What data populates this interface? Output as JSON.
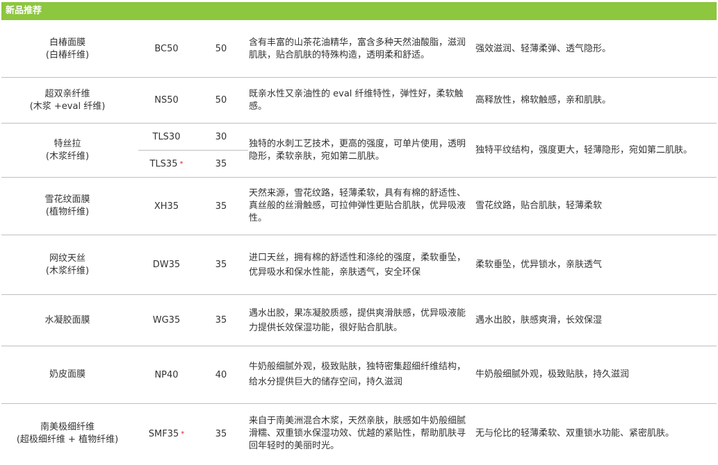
{
  "header": {
    "title": "新品推荐"
  },
  "rows": [
    {
      "name": "白椿面膜",
      "sub": "(白椿纤维)",
      "code": "BC50",
      "gsm": "50",
      "desc": "含有丰富的山茶花油精华，富含多种天然油酸脂，滋润肌肤，贴合肌肤的特殊构造，透明柔和舒适。",
      "feature": "强效滋润、轻薄柔弹、透气隐形。"
    },
    {
      "name": "超双亲纤维",
      "sub": "(木浆 +eval 纤维)",
      "code": "NS50",
      "gsm": "50",
      "desc": "既亲水性又亲油性的 eval 纤维特性，弹性好，柔软触感。",
      "feature": "高释放性，棉软触感，亲和肌肤。"
    },
    {
      "name": "特丝拉",
      "sub": "(木浆纤维)",
      "code": "TLS30",
      "gsm": "30",
      "code2": "TLS35",
      "star2": "*",
      "gsm2": "35",
      "desc": "独特的水刺工艺技术，更高的强度，可单片使用，透明隐形，柔软亲肤，宛如第二肌肤。",
      "feature": "独特平纹结构，强度更大，轻薄隐形，宛如第二肌肤。"
    },
    {
      "name": "雪花纹面膜",
      "sub": "(植物纤维)",
      "code": "XH35",
      "gsm": "35",
      "desc": "天然来源，雪花纹路，轻薄柔软，具有有棉的舒适性、真丝般的丝滑触感，可拉伸弹性更贴合肌肤，优异吸液性。",
      "feature": "雪花纹路，贴合肌肤，轻薄柔软"
    },
    {
      "name": "网纹天丝",
      "sub": "(木浆纤维)",
      "code": "DW35",
      "gsm": "35",
      "desc": "进口天丝，拥有棉的舒适性和涤纶的强度，柔软垂坠，优异吸水和保水性能，亲肤透气，安全环保",
      "feature": "柔软垂坠，优异锁水，亲肤透气"
    },
    {
      "name": "水凝胶面膜",
      "sub": "",
      "code": "WG35",
      "gsm": "35",
      "desc": "遇水出胶，果冻凝胶质感，提供爽滑肤感，优异吸液能力提供长效保湿功能，很好贴合肌肤。",
      "feature": "遇水出胶，肤感爽滑，长效保湿"
    },
    {
      "name": "奶皮面膜",
      "sub": "",
      "code": "NP40",
      "gsm": "40",
      "desc": "牛奶般细腻外观，极致贴肤，独特密集超细纤维结构，给水分提供巨大的储存空间，持久滋润",
      "feature": "牛奶般细腻外观，极致贴肤，持久滋润"
    },
    {
      "name": "南美极细纤维",
      "sub": "(超极细纤维 + 植物纤维)",
      "code": "SMF35",
      "star": "*",
      "gsm": "35",
      "desc": "来自于南美洲混合木浆，天然亲肤，肤感如牛奶般细腻滑糯、双重锁水保湿功效、优越的紧贴性，帮助肌肤寻回年轻时的美丽时光。",
      "feature": "无与伦比的轻薄柔软、双重锁水功能、紧密肌肤。"
    }
  ]
}
